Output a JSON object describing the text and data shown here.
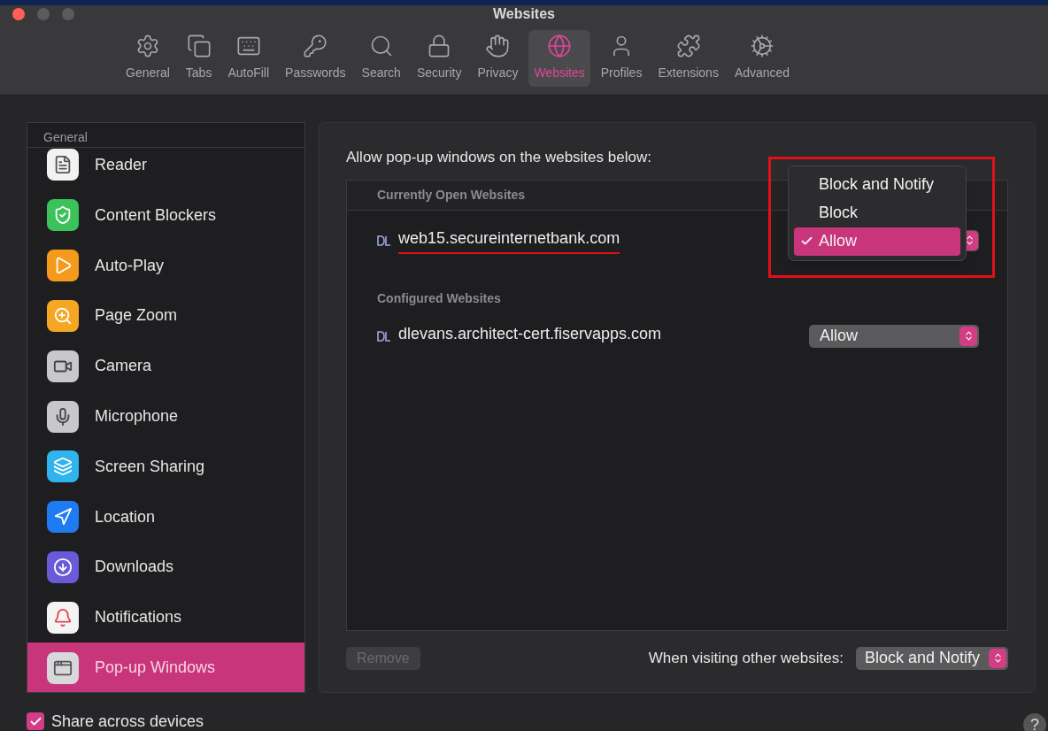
{
  "window": {
    "title": "Websites"
  },
  "toolbar": [
    {
      "label": "General",
      "selected": false
    },
    {
      "label": "Tabs",
      "selected": false
    },
    {
      "label": "AutoFill",
      "selected": false
    },
    {
      "label": "Passwords",
      "selected": false
    },
    {
      "label": "Search",
      "selected": false
    },
    {
      "label": "Security",
      "selected": false
    },
    {
      "label": "Privacy",
      "selected": false
    },
    {
      "label": "Websites",
      "selected": true
    },
    {
      "label": "Profiles",
      "selected": false
    },
    {
      "label": "Extensions",
      "selected": false
    },
    {
      "label": "Advanced",
      "selected": false
    }
  ],
  "sidebar": {
    "header": "General",
    "items": [
      {
        "label": "Reader",
        "selected": false
      },
      {
        "label": "Content Blockers",
        "selected": false
      },
      {
        "label": "Auto-Play",
        "selected": false
      },
      {
        "label": "Page Zoom",
        "selected": false
      },
      {
        "label": "Camera",
        "selected": false
      },
      {
        "label": "Microphone",
        "selected": false
      },
      {
        "label": "Screen Sharing",
        "selected": false
      },
      {
        "label": "Location",
        "selected": false
      },
      {
        "label": "Downloads",
        "selected": false
      },
      {
        "label": "Notifications",
        "selected": false
      },
      {
        "label": "Pop-up Windows",
        "selected": true
      }
    ]
  },
  "panel": {
    "heading": "Allow pop-up windows on the websites below:",
    "sections": [
      {
        "title": "Currently Open Websites",
        "sites": [
          {
            "domain": "web15.secureinternetbank.com",
            "underlined": true,
            "menu": {
              "highlighted": true,
              "options": [
                {
                  "label": "Block and Notify",
                  "selected": false
                },
                {
                  "label": "Block",
                  "selected": false
                },
                {
                  "label": "Allow",
                  "selected": true
                }
              ]
            }
          }
        ]
      },
      {
        "title": "Configured Websites",
        "sites": [
          {
            "domain": "dlevans.architect-cert.fiservapps.com",
            "underlined": false,
            "setting": "Allow"
          }
        ]
      }
    ],
    "remove_button": {
      "label": "Remove",
      "disabled": true
    },
    "other_label": "When visiting other websites:",
    "other_setting": "Block and Notify"
  },
  "share": {
    "label": "Share across devices",
    "checked": true
  },
  "help": "?"
}
